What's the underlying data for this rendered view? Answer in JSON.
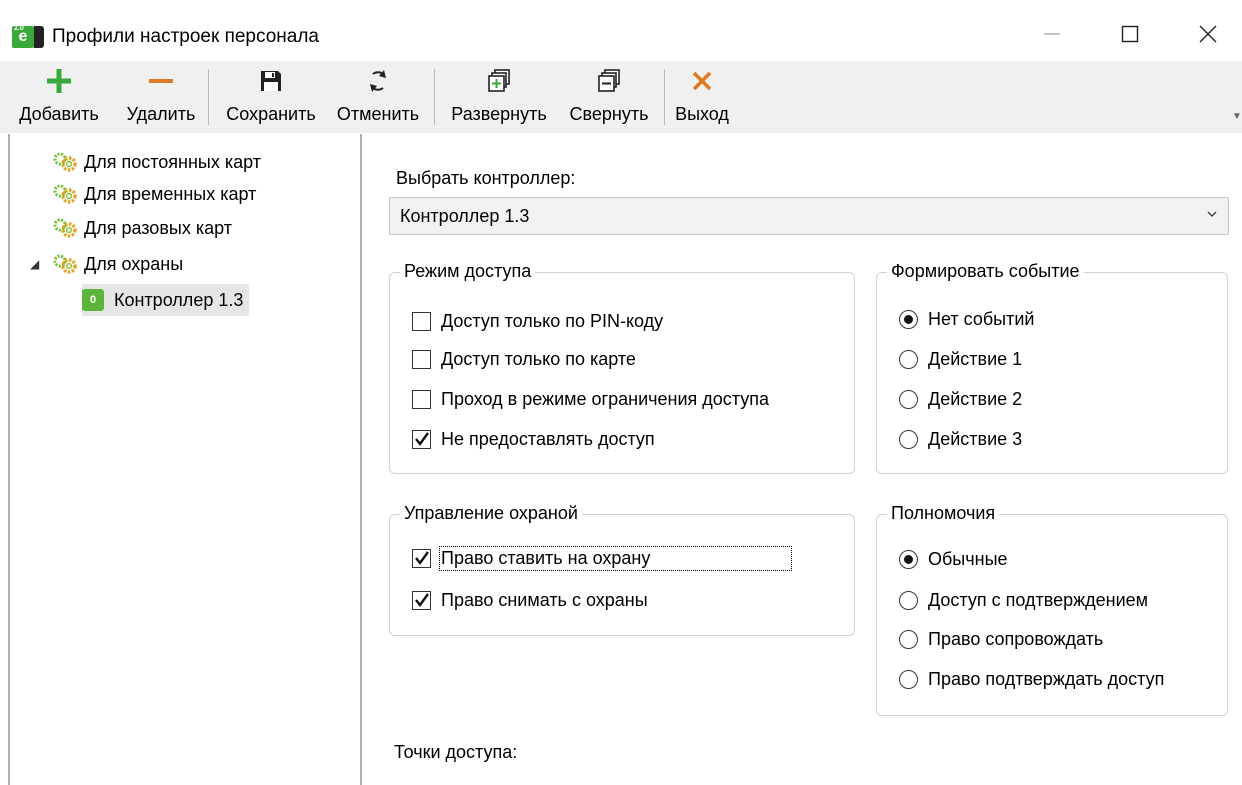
{
  "window": {
    "title": "Профили настроек персонала",
    "app_icon": "e-app-icon",
    "app_icon_version": "2.0",
    "app_icon_letter": "e",
    "controls": [
      "minimize-icon",
      "maximize-icon",
      "close-icon"
    ]
  },
  "toolbar": {
    "add_label": "Добавить",
    "delete_label": "Удалить",
    "save_label": "Сохранить",
    "cancel_label": "Отменить",
    "expand_label": "Развернуть",
    "collapse_label": "Свернуть",
    "exit_label": "Выход",
    "colors": {
      "add": "#3aa83a",
      "delete": "#e07a22",
      "exit": "#e07a22"
    }
  },
  "tree": {
    "items": [
      {
        "label": "Для постоянных карт",
        "icon": "gears-icon"
      },
      {
        "label": "Для временных карт",
        "icon": "gears-icon"
      },
      {
        "label": "Для разовых карт",
        "icon": "gears-icon"
      },
      {
        "label": "Для охраны",
        "icon": "gears-icon",
        "expanded": true,
        "children": [
          {
            "label": "Контроллер 1.3",
            "icon": "controller-icon",
            "icon_text": "0",
            "selected": true
          }
        ]
      }
    ]
  },
  "panel": {
    "controller_label": "Выбрать контроллер:",
    "controller_value": "Контроллер 1.3",
    "access_mode": {
      "title": "Режим доступа",
      "options": [
        {
          "label": "Доступ только по PIN-коду",
          "checked": false
        },
        {
          "label": "Доступ только по карте",
          "checked": false
        },
        {
          "label": "Проход в режиме ограничения доступа",
          "checked": false
        },
        {
          "label": "Не предоставлять доступ",
          "checked": true
        }
      ]
    },
    "event": {
      "title": "Формировать событие",
      "options": [
        {
          "label": "Нет событий",
          "selected": true
        },
        {
          "label": "Действие 1",
          "selected": false
        },
        {
          "label": "Действие 2",
          "selected": false
        },
        {
          "label": "Действие 3",
          "selected": false
        }
      ]
    },
    "guard": {
      "title": "Управление охраной",
      "options": [
        {
          "label": "Право ставить на охрану",
          "checked": true,
          "focused": true
        },
        {
          "label": "Право снимать с охраны",
          "checked": true
        }
      ]
    },
    "authority": {
      "title": "Полномочия",
      "options": [
        {
          "label": "Обычные",
          "selected": true
        },
        {
          "label": "Доступ с подтверждением",
          "selected": false
        },
        {
          "label": "Право сопровождать",
          "selected": false
        },
        {
          "label": "Право подтверждать доступ",
          "selected": false
        }
      ]
    },
    "access_points_label": "Точки доступа:"
  }
}
